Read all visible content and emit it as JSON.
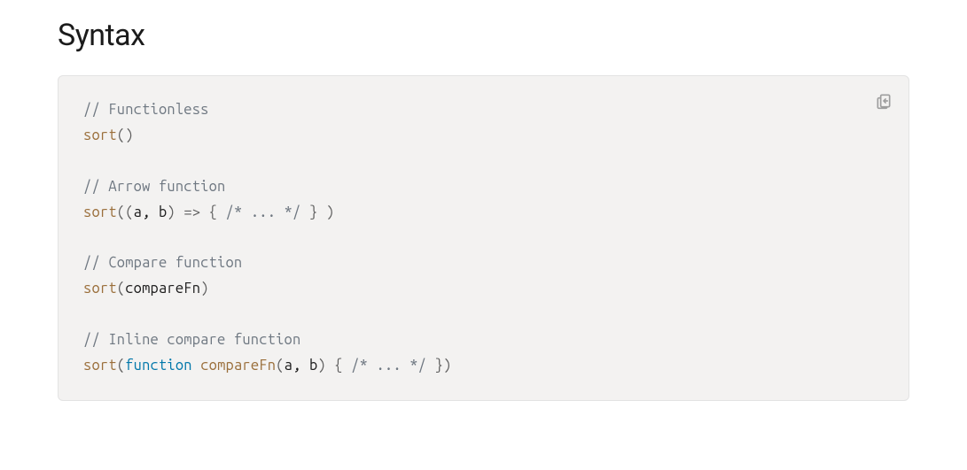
{
  "heading": "Syntax",
  "copy_icon_name": "clipboard-icon",
  "code": {
    "lines": [
      {
        "index": 0,
        "tokens": [
          {
            "cls": "tok-comment",
            "text": "// Functionless"
          }
        ]
      },
      {
        "index": 1,
        "tokens": [
          {
            "cls": "tok-fn",
            "text": "sort"
          },
          {
            "cls": "tok-punc",
            "text": "()"
          }
        ]
      },
      {
        "index": 2,
        "blank": true
      },
      {
        "index": 3,
        "tokens": [
          {
            "cls": "tok-comment",
            "text": "// Arrow function"
          }
        ]
      },
      {
        "index": 4,
        "tokens": [
          {
            "cls": "tok-fn",
            "text": "sort"
          },
          {
            "cls": "tok-punc",
            "text": "(("
          },
          {
            "cls": "tok-param",
            "text": "a, b"
          },
          {
            "cls": "tok-punc",
            "text": ") "
          },
          {
            "cls": "tok-op-arrow",
            "text": "=>"
          },
          {
            "cls": "tok-punc",
            "text": " { "
          },
          {
            "cls": "tok-comment",
            "text": "/* ... */"
          },
          {
            "cls": "tok-punc",
            "text": " } )"
          }
        ]
      },
      {
        "index": 5,
        "blank": true
      },
      {
        "index": 6,
        "tokens": [
          {
            "cls": "tok-comment",
            "text": "// Compare function"
          }
        ]
      },
      {
        "index": 7,
        "tokens": [
          {
            "cls": "tok-fn",
            "text": "sort"
          },
          {
            "cls": "tok-punc",
            "text": "("
          },
          {
            "cls": "tok-param",
            "text": "compareFn"
          },
          {
            "cls": "tok-punc",
            "text": ")"
          }
        ]
      },
      {
        "index": 8,
        "blank": true
      },
      {
        "index": 9,
        "tokens": [
          {
            "cls": "tok-comment",
            "text": "// Inline compare function"
          }
        ]
      },
      {
        "index": 10,
        "tokens": [
          {
            "cls": "tok-fn",
            "text": "sort"
          },
          {
            "cls": "tok-punc",
            "text": "("
          },
          {
            "cls": "tok-keyword",
            "text": "function"
          },
          {
            "cls": "tok-punc",
            "text": " "
          },
          {
            "cls": "tok-ident",
            "text": "compareFn"
          },
          {
            "cls": "tok-punc",
            "text": "("
          },
          {
            "cls": "tok-param",
            "text": "a, b"
          },
          {
            "cls": "tok-punc",
            "text": ") { "
          },
          {
            "cls": "tok-comment",
            "text": "/* ... */"
          },
          {
            "cls": "tok-punc",
            "text": " })"
          }
        ]
      }
    ]
  }
}
